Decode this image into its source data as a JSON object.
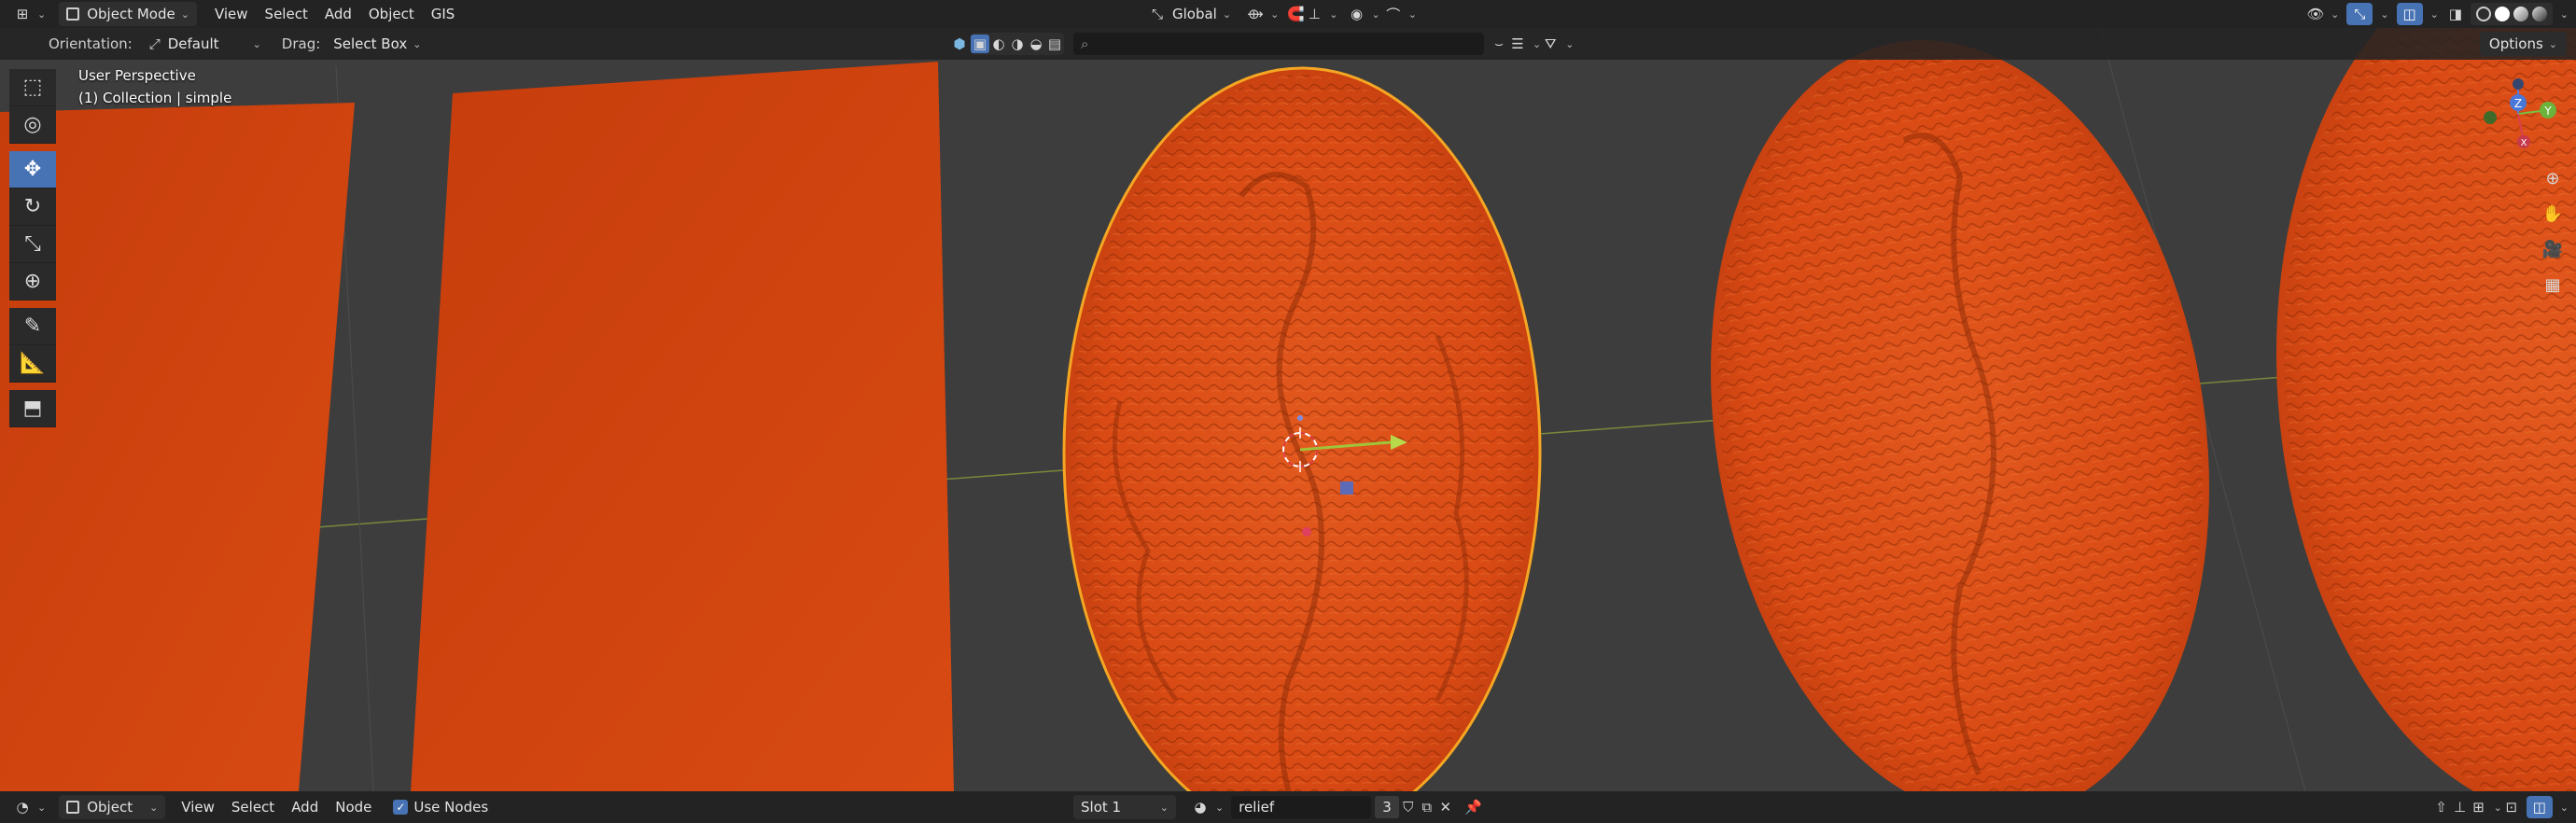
{
  "header": {
    "editor_type_icon": "viewport-editor-icon",
    "mode": "Object Mode",
    "menus": [
      "View",
      "Select",
      "Add",
      "Object",
      "GIS"
    ],
    "transform_orientation": "Global"
  },
  "tool_settings": {
    "orientation_label": "Orientation:",
    "orientation_value": "Default",
    "drag_label": "Drag:",
    "drag_value": "Select Box",
    "options_label": "Options"
  },
  "viewport": {
    "perspective": "User Perspective",
    "collection": "(1) Collection | simple",
    "gizmo": {
      "z": "Z",
      "y": "Y",
      "x": "X"
    },
    "object_color": "#d94a14",
    "background_color": "#3d3d3d"
  },
  "bottom": {
    "editor_mode": "Object",
    "menus": [
      "View",
      "Select",
      "Add",
      "Node"
    ],
    "use_nodes_label": "Use Nodes",
    "slot": "Slot 1",
    "material_name": "relief",
    "user_count": "3"
  },
  "colors": {
    "accent": "#4772b3",
    "selection_outline": "#f5a623"
  }
}
